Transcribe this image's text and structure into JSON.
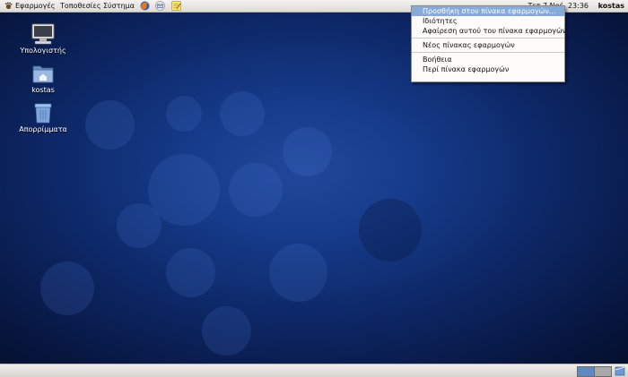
{
  "top_panel": {
    "menus": [
      "Εφαρμογές",
      "Τοποθεσίες",
      "Σύστημα"
    ],
    "launchers": [
      "firefox-icon",
      "mail-icon",
      "notes-icon"
    ],
    "clock": "Τετ  7 Νοέ, 23:36",
    "user": "kostas"
  },
  "desktop": {
    "icons": [
      {
        "label": "Υπολογιστής",
        "icon": "computer-icon"
      },
      {
        "label": "kostas",
        "icon": "home-folder-icon"
      },
      {
        "label": "Απορρίμματα",
        "icon": "trash-icon"
      }
    ]
  },
  "context_menu": {
    "items": [
      {
        "label": "Προσθήκη στον πίνακα εφαρμογών...",
        "selected": true
      },
      {
        "label": "Ιδιότητες"
      },
      {
        "label": "Αφαίρεση αυτού του πίνακα εφαρμογών"
      },
      {
        "label": "Νέος πίνακας εφαρμογών"
      },
      {
        "label": "Βοήθεια"
      },
      {
        "label": "Περί πίνακα εφαρμογών"
      }
    ]
  },
  "bottom_panel": {
    "workspaces": [
      "workspace-1",
      "workspace-2"
    ],
    "active_workspace": 1
  },
  "colors": {
    "desktop_bg": "#163b8a",
    "menu_highlight": "#86abd9",
    "panel_bg": "#e8e6e3"
  }
}
